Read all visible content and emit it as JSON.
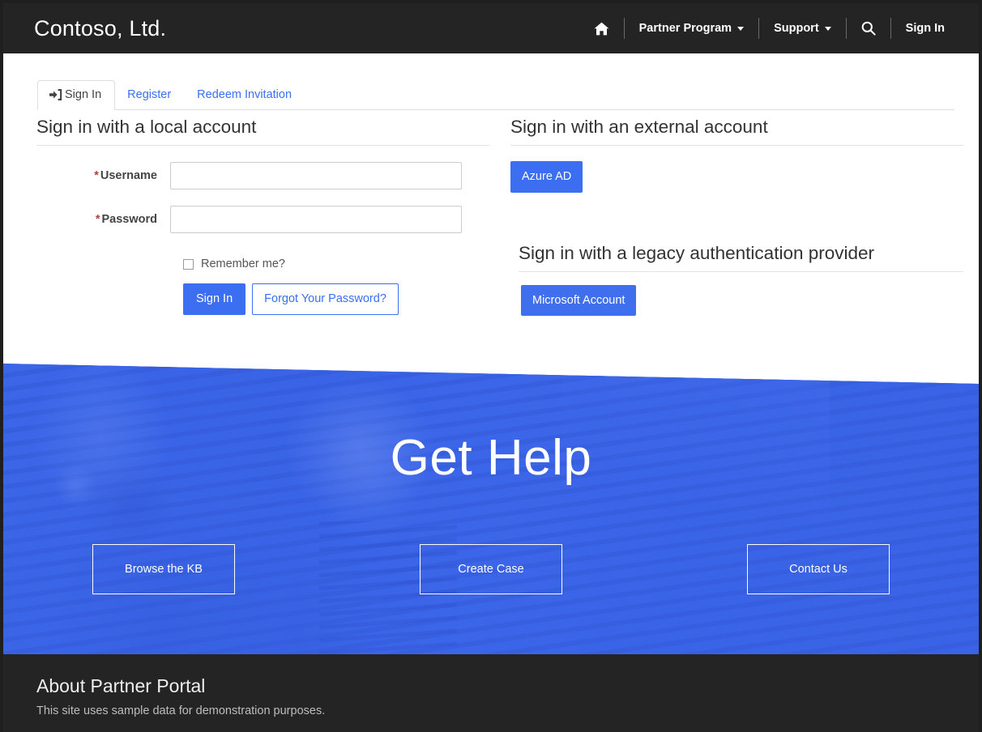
{
  "header": {
    "brand": "Contoso, Ltd.",
    "home_icon": "home-icon",
    "search_icon": "search-icon",
    "nav": [
      {
        "label": "Partner Program",
        "has_caret": true
      },
      {
        "label": "Support",
        "has_caret": true
      },
      {
        "label": "Sign In",
        "has_caret": false
      }
    ]
  },
  "tabs": [
    {
      "label": "Sign In",
      "icon": "sign-in-icon",
      "active": true
    },
    {
      "label": "Register",
      "icon": "",
      "active": false
    },
    {
      "label": "Redeem Invitation",
      "icon": "",
      "active": false
    }
  ],
  "local_account": {
    "heading": "Sign in with a local account",
    "username": {
      "required_marker": "*",
      "label": "Username",
      "value": "",
      "placeholder": ""
    },
    "password": {
      "required_marker": "*",
      "label": "Password",
      "value": "",
      "placeholder": ""
    },
    "remember_label": "Remember me?",
    "remember_checked": false,
    "sign_in_button": "Sign In",
    "forgot_password_button": "Forgot Your Password?"
  },
  "external_account": {
    "heading": "Sign in with an external account",
    "providers": [
      {
        "label": "Azure AD"
      }
    ]
  },
  "legacy_provider": {
    "heading": "Sign in with a legacy authentication provider",
    "providers": [
      {
        "label": "Microsoft Account"
      }
    ]
  },
  "hero": {
    "title": "Get Help",
    "buttons": [
      {
        "label": "Browse the KB"
      },
      {
        "label": "Create Case"
      },
      {
        "label": "Contact Us"
      }
    ]
  },
  "footer": {
    "title": "About Partner Portal",
    "text": "This site uses sample data for demonstration purposes."
  },
  "colors": {
    "header_bg": "#242424",
    "accent_blue": "#3b6ef0",
    "legacy_blue": "#3f6fec",
    "hero_blue": "#3a63e0",
    "required_red": "#a94442",
    "footer_bg": "#242424"
  }
}
